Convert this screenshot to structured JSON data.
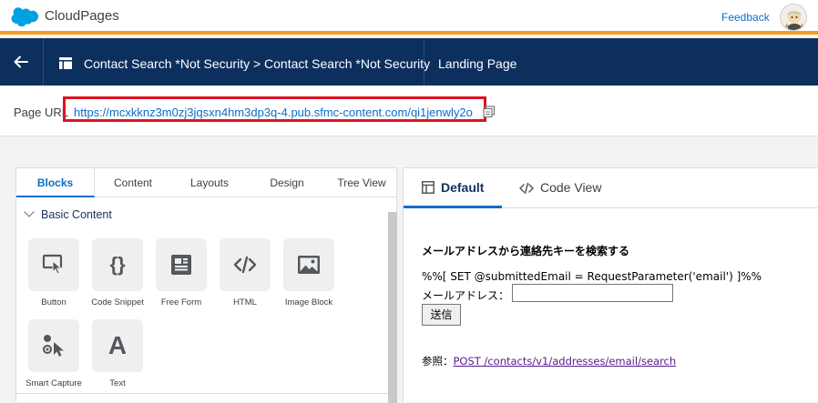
{
  "header": {
    "app_title": "CloudPages",
    "feedback_label": "Feedback",
    "brand_color": "#00a1e0",
    "accent_color": "#f49d1b"
  },
  "nav": {
    "back_icon": "arrow-left-icon",
    "breadcrumb": "Contact Search *Not Security > Contact Search *Not Security",
    "page_type": "Landing Page",
    "background_color": "#0d2f5e"
  },
  "url_bar": {
    "label": "Page URL",
    "url": "https://mcxkknz3m0zj3jqsxn4hm3dp3q-4.pub.sfmc-content.com/qi1jenwly2o",
    "highlight_color": "#e1121f"
  },
  "left_panel": {
    "tabs": [
      {
        "label": "Blocks",
        "active": true
      },
      {
        "label": "Content",
        "active": false
      },
      {
        "label": "Layouts",
        "active": false
      },
      {
        "label": "Design",
        "active": false
      },
      {
        "label": "Tree View",
        "active": false
      }
    ],
    "section_title": "Basic Content",
    "blocks": [
      {
        "label": "Button",
        "icon": "button-click-icon"
      },
      {
        "label": "Code Snippet",
        "icon": "curly-braces-icon"
      },
      {
        "label": "Free Form",
        "icon": "text-document-icon"
      },
      {
        "label": "HTML",
        "icon": "code-tag-icon"
      },
      {
        "label": "Image Block",
        "icon": "image-icon"
      },
      {
        "label": "Smart Capture",
        "icon": "form-cursor-icon"
      },
      {
        "label": "Text",
        "icon": "letter-a-icon"
      }
    ]
  },
  "right_panel": {
    "tabs": [
      {
        "label": "Default",
        "icon": "layout-icon",
        "active": true
      },
      {
        "label": "Code View",
        "icon": "code-icon",
        "active": false
      }
    ],
    "preview": {
      "heading": "メールアドレスから連絡先キーを検索する",
      "code_line": "%%[ SET @submittedEmail = RequestParameter('email') ]%%",
      "email_label": "メールアドレス：",
      "email_value": "",
      "submit_label": "送信",
      "ref_prefix": "参照：",
      "ref_link": "POST /contacts/v1/addresses/email/search"
    }
  }
}
